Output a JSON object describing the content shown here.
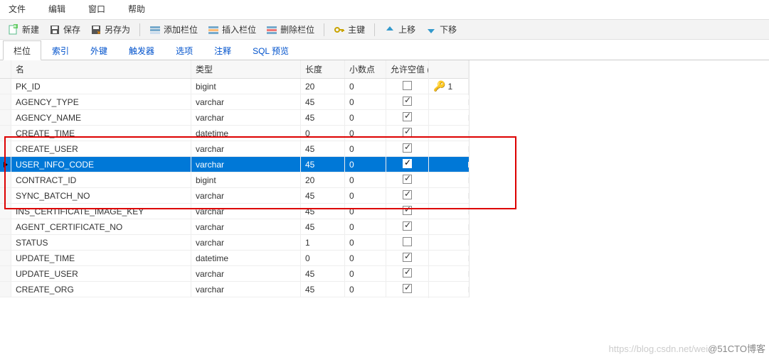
{
  "menu": {
    "file": "文件",
    "edit": "编辑",
    "window": "窗口",
    "help": "帮助"
  },
  "toolbar": {
    "new": "新建",
    "save": "保存",
    "saveas": "另存为",
    "addcol": "添加栏位",
    "insertcol": "插入栏位",
    "delcol": "删除栏位",
    "pk": "主键",
    "up": "上移",
    "down": "下移"
  },
  "tabs": {
    "fields": "栏位",
    "index": "索引",
    "fk": "外键",
    "trigger": "触发器",
    "options": "选项",
    "comment": "注释",
    "sqlpreview": "SQL 预览"
  },
  "headers": {
    "name": "名",
    "type": "类型",
    "length": "长度",
    "decimal": "小数点",
    "nullable": "允许空值 ("
  },
  "keylabel": "1",
  "rows": [
    {
      "name": "PK_ID",
      "type": "bigint",
      "len": "20",
      "dec": "0",
      "null": false,
      "pk": true
    },
    {
      "name": "AGENCY_TYPE",
      "type": "varchar",
      "len": "45",
      "dec": "0",
      "null": true,
      "pk": false
    },
    {
      "name": "AGENCY_NAME",
      "type": "varchar",
      "len": "45",
      "dec": "0",
      "null": true,
      "pk": false
    },
    {
      "name": "CREATE_TIME",
      "type": "datetime",
      "len": "0",
      "dec": "0",
      "null": true,
      "pk": false
    },
    {
      "name": "CREATE_USER",
      "type": "varchar",
      "len": "45",
      "dec": "0",
      "null": true,
      "pk": false
    },
    {
      "name": "USER_INFO_CODE",
      "type": "varchar",
      "len": "45",
      "dec": "0",
      "null": true,
      "pk": false,
      "selected": true
    },
    {
      "name": "CONTRACT_ID",
      "type": "bigint",
      "len": "20",
      "dec": "0",
      "null": true,
      "pk": false
    },
    {
      "name": "SYNC_BATCH_NO",
      "type": "varchar",
      "len": "45",
      "dec": "0",
      "null": true,
      "pk": false
    },
    {
      "name": "INS_CERTIFICATE_IMAGE_KEY",
      "type": "varchar",
      "len": "45",
      "dec": "0",
      "null": true,
      "pk": false
    },
    {
      "name": "AGENT_CERTIFICATE_NO",
      "type": "varchar",
      "len": "45",
      "dec": "0",
      "null": true,
      "pk": false
    },
    {
      "name": "STATUS",
      "type": "varchar",
      "len": "1",
      "dec": "0",
      "null": false,
      "pk": false
    },
    {
      "name": "UPDATE_TIME",
      "type": "datetime",
      "len": "0",
      "dec": "0",
      "null": true,
      "pk": false
    },
    {
      "name": "UPDATE_USER",
      "type": "varchar",
      "len": "45",
      "dec": "0",
      "null": true,
      "pk": false
    },
    {
      "name": "CREATE_ORG",
      "type": "varchar",
      "len": "45",
      "dec": "0",
      "null": true,
      "pk": false
    }
  ],
  "watermark": {
    "faint": "https://blog.csdn.net/wei",
    "dark": "@51CTO博客"
  }
}
